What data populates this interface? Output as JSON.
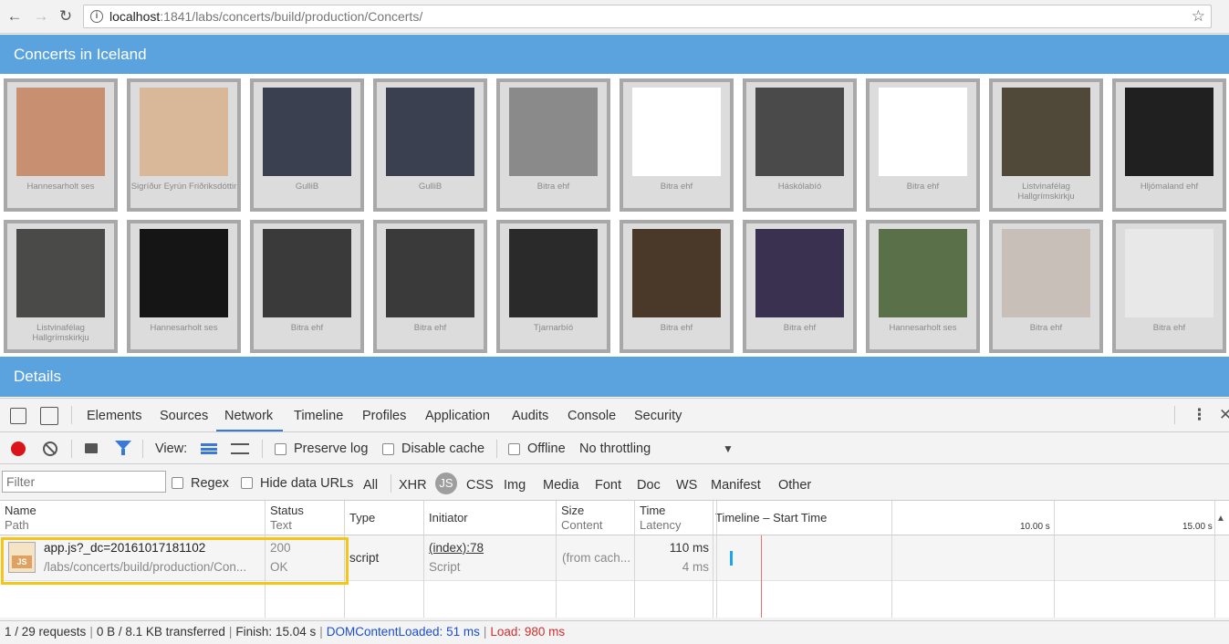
{
  "browser": {
    "url_host": "localhost",
    "url_path": ":1841/labs/concerts/build/production/Concerts/"
  },
  "app": {
    "title": "Concerts in Iceland",
    "details_title": "Details",
    "concerts_row1": [
      {
        "caption": "Hannesarholt ses",
        "img": "#c89070"
      },
      {
        "caption": "Sigríður Eyrún Friðriksdóttir",
        "img": "#d8b898"
      },
      {
        "caption": "GulliB",
        "img": "#3a4050"
      },
      {
        "caption": "GulliB",
        "img": "#3a4050"
      },
      {
        "caption": "Bitra ehf",
        "img": "#8a8a8a"
      },
      {
        "caption": "Bitra ehf",
        "img": "#ffffff"
      },
      {
        "caption": "Háskólabíó",
        "img": "#4a4a4a"
      },
      {
        "caption": "Bitra ehf",
        "img": "#ffffff"
      },
      {
        "caption": "Listvinafélag Hallgrímskirkju",
        "img": "#504838"
      },
      {
        "caption": "Hljómaland ehf",
        "img": "#202020"
      }
    ],
    "concerts_row2": [
      {
        "caption": "Listvinafélag Hallgrímskirkju",
        "img": "#4a4a48"
      },
      {
        "caption": "Hannesarholt ses",
        "img": "#151515"
      },
      {
        "caption": "Bitra ehf",
        "img": "#3a3a3a"
      },
      {
        "caption": "Bitra ehf",
        "img": "#3a3a3a"
      },
      {
        "caption": "Tjarnarbíó",
        "img": "#2a2a2a"
      },
      {
        "caption": "Bitra ehf",
        "img": "#4a3828"
      },
      {
        "caption": "Bitra ehf",
        "img": "#3a3050"
      },
      {
        "caption": "Hannesarholt ses",
        "img": "#5a7048"
      },
      {
        "caption": "Bitra ehf",
        "img": "#c8c0b8"
      },
      {
        "caption": "Bitra ehf",
        "img": "#e8e8e8"
      }
    ]
  },
  "devtools": {
    "tabs": [
      "Elements",
      "Sources",
      "Network",
      "Timeline",
      "Profiles",
      "Application",
      "Audits",
      "Console",
      "Security"
    ],
    "active_tab": "Network",
    "toolbar": {
      "view_label": "View:",
      "preserve_log": "Preserve log",
      "disable_cache": "Disable cache",
      "offline": "Offline",
      "throttling": "No throttling"
    },
    "filter": {
      "placeholder": "Filter",
      "regex": "Regex",
      "hide_data_urls": "Hide data URLs",
      "types": [
        "All",
        "XHR",
        "JS",
        "CSS",
        "Img",
        "Media",
        "Font",
        "Doc",
        "WS",
        "Manifest",
        "Other"
      ],
      "selected_type": "JS"
    },
    "columns": {
      "name": "Name",
      "path": "Path",
      "status": "Status",
      "text": "Text",
      "type": "Type",
      "initiator": "Initiator",
      "size": "Size",
      "content": "Content",
      "time": "Time",
      "latency": "Latency",
      "timeline": "Timeline – Start Time",
      "tick1": "10.00 s",
      "tick2": "15.00 s"
    },
    "request": {
      "icon_label": "JS",
      "name": "app.js?_dc=20161017181102",
      "path": "/labs/concerts/build/production/Con...",
      "status": "200",
      "status_text": "OK",
      "type": "script",
      "initiator": "(index):78",
      "initiator_type": "Script",
      "size": "(from cach...",
      "time": "110 ms",
      "latency": "4 ms"
    },
    "status": {
      "requests": "1 / 29 requests",
      "transferred": "0 B / 8.1 KB transferred",
      "finish": "Finish: 15.04 s",
      "dcl": "DOMContentLoaded: 51 ms",
      "load": "Load: 980 ms",
      "dcl_color": "#1a4fd1",
      "load_color": "#d32f2f"
    }
  }
}
